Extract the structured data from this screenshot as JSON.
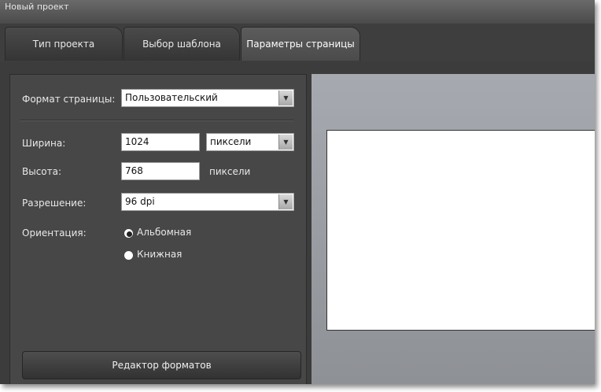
{
  "window": {
    "title": "Новый проект"
  },
  "tabs": [
    {
      "label": "Тип проекта"
    },
    {
      "label": "Выбор шаблона"
    },
    {
      "label": "Параметры страницы"
    }
  ],
  "form": {
    "page_format": {
      "label": "Формат страницы:",
      "value": "Пользовательский"
    },
    "width": {
      "label": "Ширина:",
      "value": "1024",
      "unit": "пиксели"
    },
    "height": {
      "label": "Высота:",
      "value": "768",
      "unit": "пиксели"
    },
    "resolution": {
      "label": "Разрешение:",
      "value": "96 dpi"
    },
    "orientation": {
      "label": "Ориентация:",
      "options": [
        {
          "label": "Альбомная",
          "checked": true
        },
        {
          "label": "Книжная",
          "checked": false
        }
      ]
    }
  },
  "buttons": {
    "format_editor": "Редактор форматов"
  },
  "icons": {
    "dropdown": "chevron-down-icon"
  },
  "colors": {
    "background": "#3c3c3c",
    "panel": "#474747",
    "preview": "#9a9da2"
  }
}
